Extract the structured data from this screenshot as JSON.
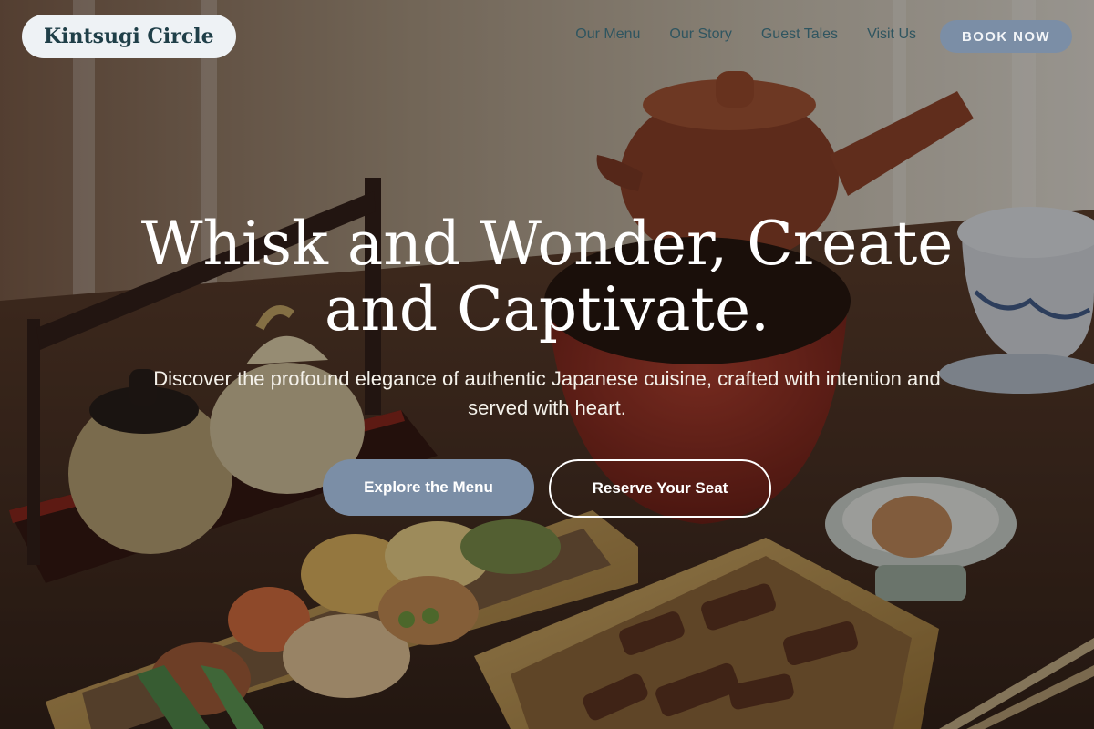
{
  "header": {
    "brand": "Kintsugi Circle",
    "nav": [
      {
        "label": "Our Menu"
      },
      {
        "label": "Our Story"
      },
      {
        "label": "Guest Tales"
      },
      {
        "label": "Visit Us"
      }
    ],
    "book_label": "BOOK NOW"
  },
  "hero": {
    "headline": "Whisk and Wonder, Create and Captivate.",
    "subhead": "Discover the profound elegance of authentic Japanese cuisine, crafted with intention and served with heart.",
    "primary_cta": "Explore the Menu",
    "secondary_cta": "Reserve Your Seat"
  },
  "colors": {
    "accent": "#7b8ea6",
    "logo_bg": "#eef2f5",
    "nav_text": "#2f5560",
    "brand_text": "#1f3f48"
  }
}
